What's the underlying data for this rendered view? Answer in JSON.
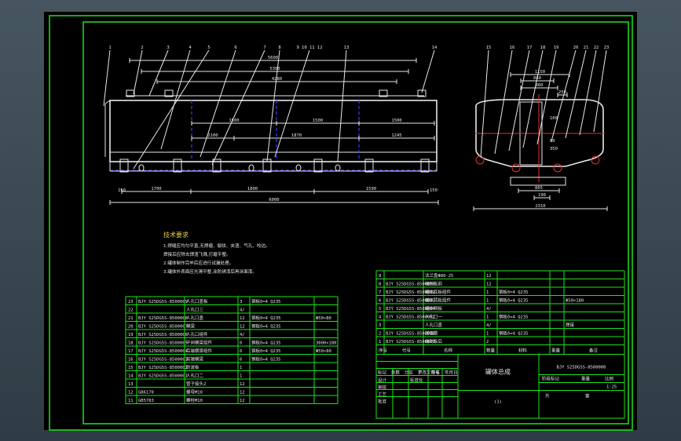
{
  "balloons_side": [
    "1",
    "2",
    "3",
    "4",
    "5",
    "6",
    "7",
    "8",
    "9 10 11 12",
    "13",
    "14"
  ],
  "balloons_end": [
    "15",
    "16",
    "17",
    "18",
    "19",
    "20",
    "21",
    "22",
    "23"
  ],
  "dims_side": {
    "top": [
      "5600",
      "5300",
      "4280"
    ],
    "mid": [
      "1500",
      "1500",
      "1500"
    ],
    "low": [
      "2100",
      "1870",
      "1245"
    ],
    "bottom": [
      "1700",
      "1800",
      "1590"
    ],
    "overall": "6000",
    "small_left": "150",
    "small_right": "150"
  },
  "dims_end": {
    "top": [
      "1150",
      "860",
      "960",
      "250"
    ],
    "side": [
      "100",
      "80",
      "350"
    ],
    "bottom": [
      "865",
      "190"
    ],
    "overall": "2310"
  },
  "notes": {
    "title": "技术要求",
    "lines": [
      "1.焊缝应均匀平直,无焊瘤、裂纹、夹渣、气孔、咬边。",
      "焊接后应除去焊渣飞溅,打磨平整。",
      "2.罐体制作完毕后应进行试漏处理。",
      "3.罐体外表面应光滑平整,涂防锈漆后再涂面漆。"
    ]
  },
  "bom_left": [
    {
      "no": "23",
      "code": "BJY S25DG5S-8500009",
      "name": "人孔口盖板",
      "qty": "3",
      "mat": "钢板δ=4 Q235",
      "note": ""
    },
    {
      "no": "22",
      "code": "",
      "name": "人孔口三",
      "qty": "4/",
      "mat": "",
      "note": ""
    },
    {
      "no": "21",
      "code": "BJY S25DG5S-8500008",
      "name": "人孔口盖",
      "qty": "12",
      "mat": "钢板δ=4 Q235",
      "note": "Φ50×80"
    },
    {
      "no": "20",
      "code": "BJY S25DG5S-8500007",
      "name": "横梁",
      "qty": "12",
      "mat": "钢板δ=4 Q235",
      "note": ""
    },
    {
      "no": "19",
      "code": "BJY S25DG5S-8500006",
      "name": "人孔口组件",
      "qty": "4/",
      "mat": "",
      "note": ""
    },
    {
      "no": "18",
      "code": "BJY S25DG5S-8500005",
      "name": "中间横梁组件",
      "qty": "6",
      "mat": "钢板δ=4 Q235",
      "note": "3000×180"
    },
    {
      "no": "17",
      "code": "BJY S25DG5S-8500004",
      "name": "后端横梁组件",
      "qty": "6",
      "mat": "钢板δ=4 Q235",
      "note": "Φ50×80"
    },
    {
      "no": "16",
      "code": "BJY S25DG5S-8500003",
      "name": "前端横梁",
      "qty": "6",
      "mat": "钢板δ=4 Q235",
      "note": ""
    },
    {
      "no": "15",
      "code": "BJY S25DG5S-8500002",
      "name": "防波板",
      "qty": "1",
      "mat": "",
      "note": ""
    },
    {
      "no": "14",
      "code": "BJY S25DG5S-8500001",
      "name": "人孔口二",
      "qty": "1",
      "mat": "",
      "note": ""
    },
    {
      "no": "13",
      "code": "",
      "name": "管子接头2",
      "qty": "12",
      "mat": "",
      "note": ""
    },
    {
      "no": "12",
      "code": "GB6170",
      "name": "螺母M10",
      "qty": "12",
      "mat": "",
      "note": ""
    },
    {
      "no": "11",
      "code": "GB5783",
      "name": "螺栓M10",
      "qty": "12",
      "mat": "",
      "note": ""
    }
  ],
  "bom_right": [
    {
      "no": "9",
      "code": "",
      "name": "法兰盘Φ80-25",
      "qty": "12",
      "mat": "",
      "note": ""
    },
    {
      "no": "8",
      "code": "BJY S25DG5S-8500006",
      "name": "端封板前",
      "qty": "12",
      "mat": "",
      "note": ""
    },
    {
      "no": "7",
      "code": "BJY S25DG5S-8500002",
      "name": "罐体底板组件",
      "qty": "1",
      "mat": "钢板δ=4 Q235",
      "note": ""
    },
    {
      "no": "6",
      "code": "BJY S25DG5S-8500003",
      "name": "罐体顶板组件",
      "qty": "1",
      "mat": "钢板δ=4 Q235",
      "note": "Φ50×180"
    },
    {
      "no": "5",
      "code": "BJY S25DG5S-8500004",
      "name": "罐体侧板",
      "qty": "4/",
      "mat": "",
      "note": ""
    },
    {
      "no": "4",
      "code": "BJY S25DG5S-8500001",
      "name": "人孔口一",
      "qty": "1",
      "mat": "钢板δ=4 Q235",
      "note": ""
    },
    {
      "no": "3",
      "code": "",
      "name": "人孔口盖",
      "qty": "4/",
      "mat": "",
      "note": "焊接"
    },
    {
      "no": "2",
      "code": "BJY S25DG5S-8500000",
      "name": "加强筋",
      "qty": "1",
      "mat": "钢板δ=4 Q235",
      "note": ""
    },
    {
      "no": "1",
      "code": "BJY S25DG5S-8500001",
      "name": "端封板后",
      "qty": "2",
      "mat": "",
      "note": ""
    }
  ],
  "bom_header": {
    "no": "序号",
    "code": "代号",
    "name": "名称",
    "qty": "数量",
    "mat": "材料",
    "weight": "重量",
    "note": "备注"
  },
  "title_block": {
    "drawing_name": "罐体总成",
    "drawing_no": "BJY S25DG5S-8500000",
    "scale_label": "1:25",
    "sheet": "(1)",
    "stage_label": "阶段标记",
    "weight_label": "重量",
    "scale_head": "比例",
    "sheets_label": "共",
    "page_label": "第",
    "rows": [
      "标记",
      "处数",
      "分区",
      "更改文件号",
      "签名",
      "年月日"
    ],
    "people": [
      "设计",
      "审核",
      "工艺",
      "批准"
    ],
    "std": "标准化"
  }
}
